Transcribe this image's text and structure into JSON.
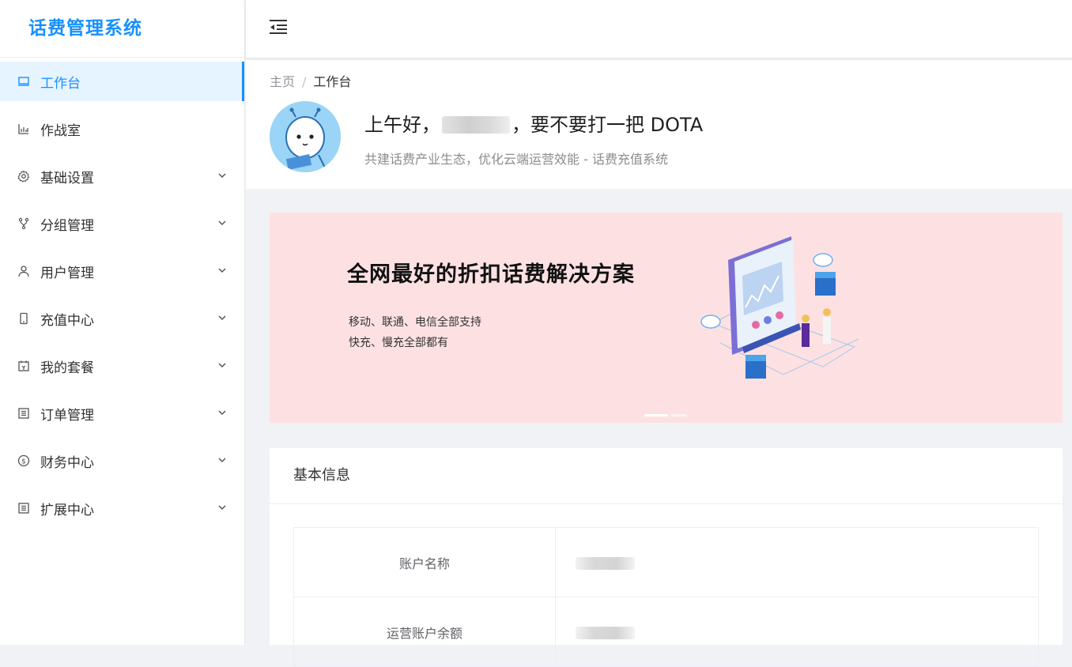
{
  "app": {
    "title": "话费管理系统"
  },
  "sidebar": {
    "items": [
      {
        "label": "工作台",
        "icon": "laptop-icon",
        "active": true,
        "expandable": false
      },
      {
        "label": "作战室",
        "icon": "bar-chart-icon",
        "active": false,
        "expandable": false
      },
      {
        "label": "基础设置",
        "icon": "gear-icon",
        "active": false,
        "expandable": true
      },
      {
        "label": "分组管理",
        "icon": "branch-icon",
        "active": false,
        "expandable": true
      },
      {
        "label": "用户管理",
        "icon": "user-icon",
        "active": false,
        "expandable": true
      },
      {
        "label": "充值中心",
        "icon": "mobile-icon",
        "active": false,
        "expandable": true
      },
      {
        "label": "我的套餐",
        "icon": "calendar-icon",
        "active": false,
        "expandable": true
      },
      {
        "label": "订单管理",
        "icon": "list-icon",
        "active": false,
        "expandable": true
      },
      {
        "label": "财务中心",
        "icon": "dollar-icon",
        "active": false,
        "expandable": true
      },
      {
        "label": "扩展中心",
        "icon": "list-icon",
        "active": false,
        "expandable": true
      }
    ]
  },
  "breadcrumb": {
    "home": "主页",
    "separator": "/",
    "current": "工作台"
  },
  "greeting": {
    "prefix": "上午好，",
    "suffix": "，要不要打一把 DOTA",
    "subtitle": "共建话费产业生态，优化云端运营效能 - 话费充值系统"
  },
  "banner": {
    "title": "全网最好的折扣话费解决方案",
    "line1": "移动、联通、电信全部支持",
    "line2": "快充、慢充全部都有",
    "background": "#fde1e2"
  },
  "info_card": {
    "title": "基本信息",
    "rows": [
      {
        "label": "账户名称"
      },
      {
        "label": "运营账户余额"
      }
    ]
  },
  "colors": {
    "accent": "#1890ff",
    "active_bg": "#e6f4ff"
  }
}
